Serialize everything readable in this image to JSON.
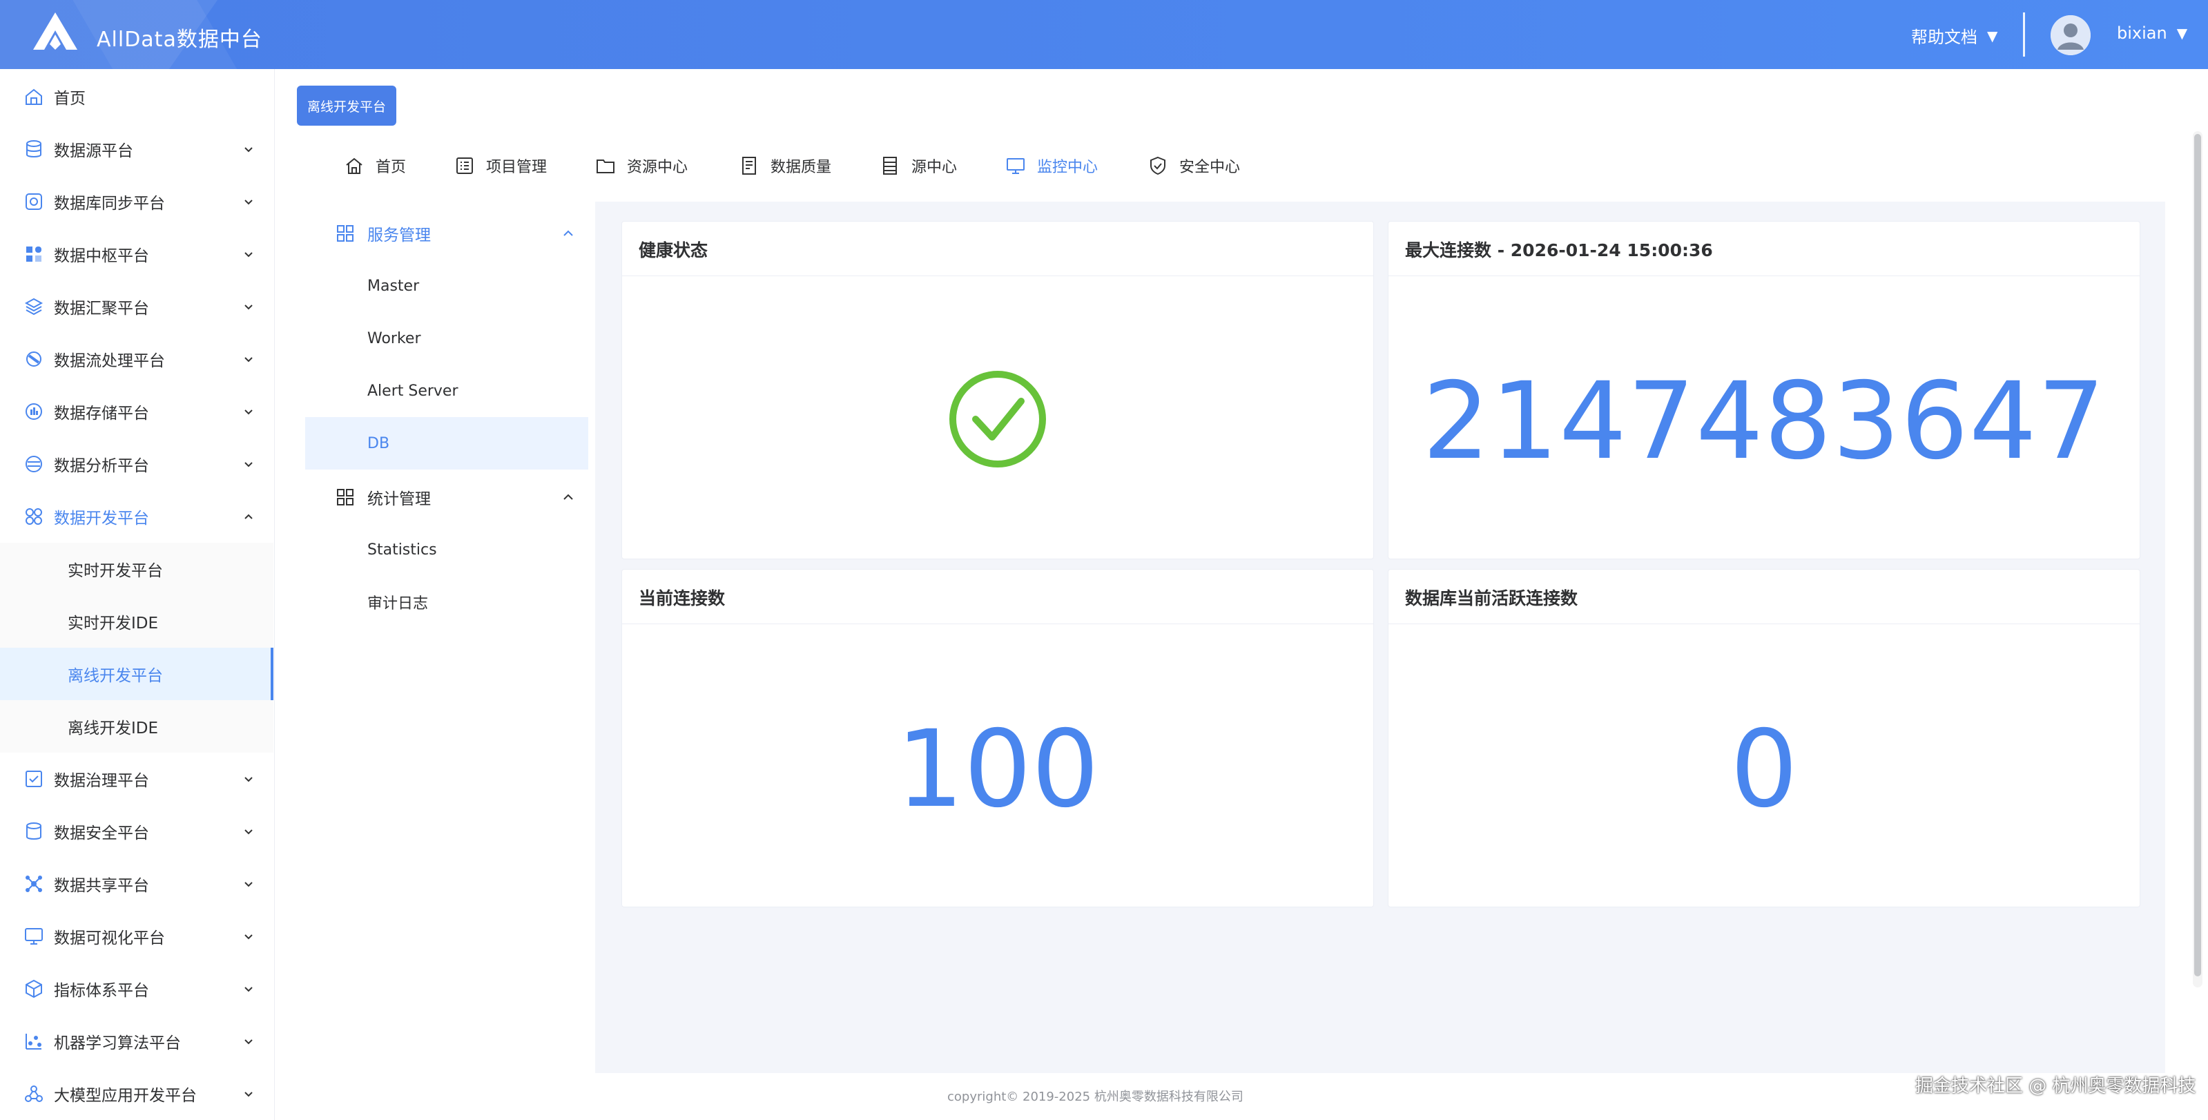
{
  "app": {
    "title": "AllData数据中台",
    "help_docs": "帮助文档",
    "username": "bixian",
    "caret": "▼"
  },
  "sidebar": {
    "items": [
      {
        "label": "首页",
        "icon": "home-icon"
      },
      {
        "label": "数据源平台",
        "icon": "database-icon"
      },
      {
        "label": "数据库同步平台",
        "icon": "sync-icon"
      },
      {
        "label": "数据中枢平台",
        "icon": "hub-icon"
      },
      {
        "label": "数据汇聚平台",
        "icon": "layers-icon"
      },
      {
        "label": "数据流处理平台",
        "icon": "stream-icon"
      },
      {
        "label": "数据存储平台",
        "icon": "storage-icon"
      },
      {
        "label": "数据分析平台",
        "icon": "analysis-icon"
      },
      {
        "label": "数据开发平台",
        "icon": "dev-icon"
      },
      {
        "label": "数据治理平台",
        "icon": "governance-icon"
      },
      {
        "label": "数据安全平台",
        "icon": "security-icon"
      },
      {
        "label": "数据共享平台",
        "icon": "share-icon"
      },
      {
        "label": "数据可视化平台",
        "icon": "monitor-icon"
      },
      {
        "label": "指标体系平台",
        "icon": "cube-icon"
      },
      {
        "label": "机器学习算法平台",
        "icon": "ml-icon"
      },
      {
        "label": "大模型应用开发平台",
        "icon": "llm-icon"
      }
    ],
    "dev_subitems": [
      "实时开发平台",
      "实时开发IDE",
      "离线开发平台",
      "离线开发IDE"
    ]
  },
  "platform_button": "离线开发平台",
  "top_nav": [
    {
      "label": "首页",
      "icon": "home-icon"
    },
    {
      "label": "项目管理",
      "icon": "list-icon"
    },
    {
      "label": "资源中心",
      "icon": "folder-icon"
    },
    {
      "label": "数据质量",
      "icon": "document-icon"
    },
    {
      "label": "源中心",
      "icon": "table-icon"
    },
    {
      "label": "监控中心",
      "icon": "monitor-icon"
    },
    {
      "label": "安全中心",
      "icon": "shield-icon"
    }
  ],
  "sub_nav": {
    "service_group": "服务管理",
    "service_items": [
      "Master",
      "Worker",
      "Alert Server",
      "DB"
    ],
    "stats_group": "统计管理",
    "stats_items": [
      "Statistics",
      "审计日志"
    ]
  },
  "cards": {
    "health": {
      "title": "健康状态",
      "status": "healthy"
    },
    "max_conn": {
      "title": "最大连接数 - 2026-01-24 15:00:36",
      "value": "2147483647"
    },
    "current_conn": {
      "title": "当前连接数",
      "value": "100"
    },
    "active_conn": {
      "title": "数据库当前活跃连接数",
      "value": "0"
    }
  },
  "footer": "copyright© 2019-2025 杭州奥零数据科技有限公司",
  "watermark": "掘金技术社区 @ 杭州奥零数据科技",
  "colors": {
    "accent": "#4a86ee",
    "header": "#4a7fe8",
    "health_ok": "#67c23a"
  }
}
